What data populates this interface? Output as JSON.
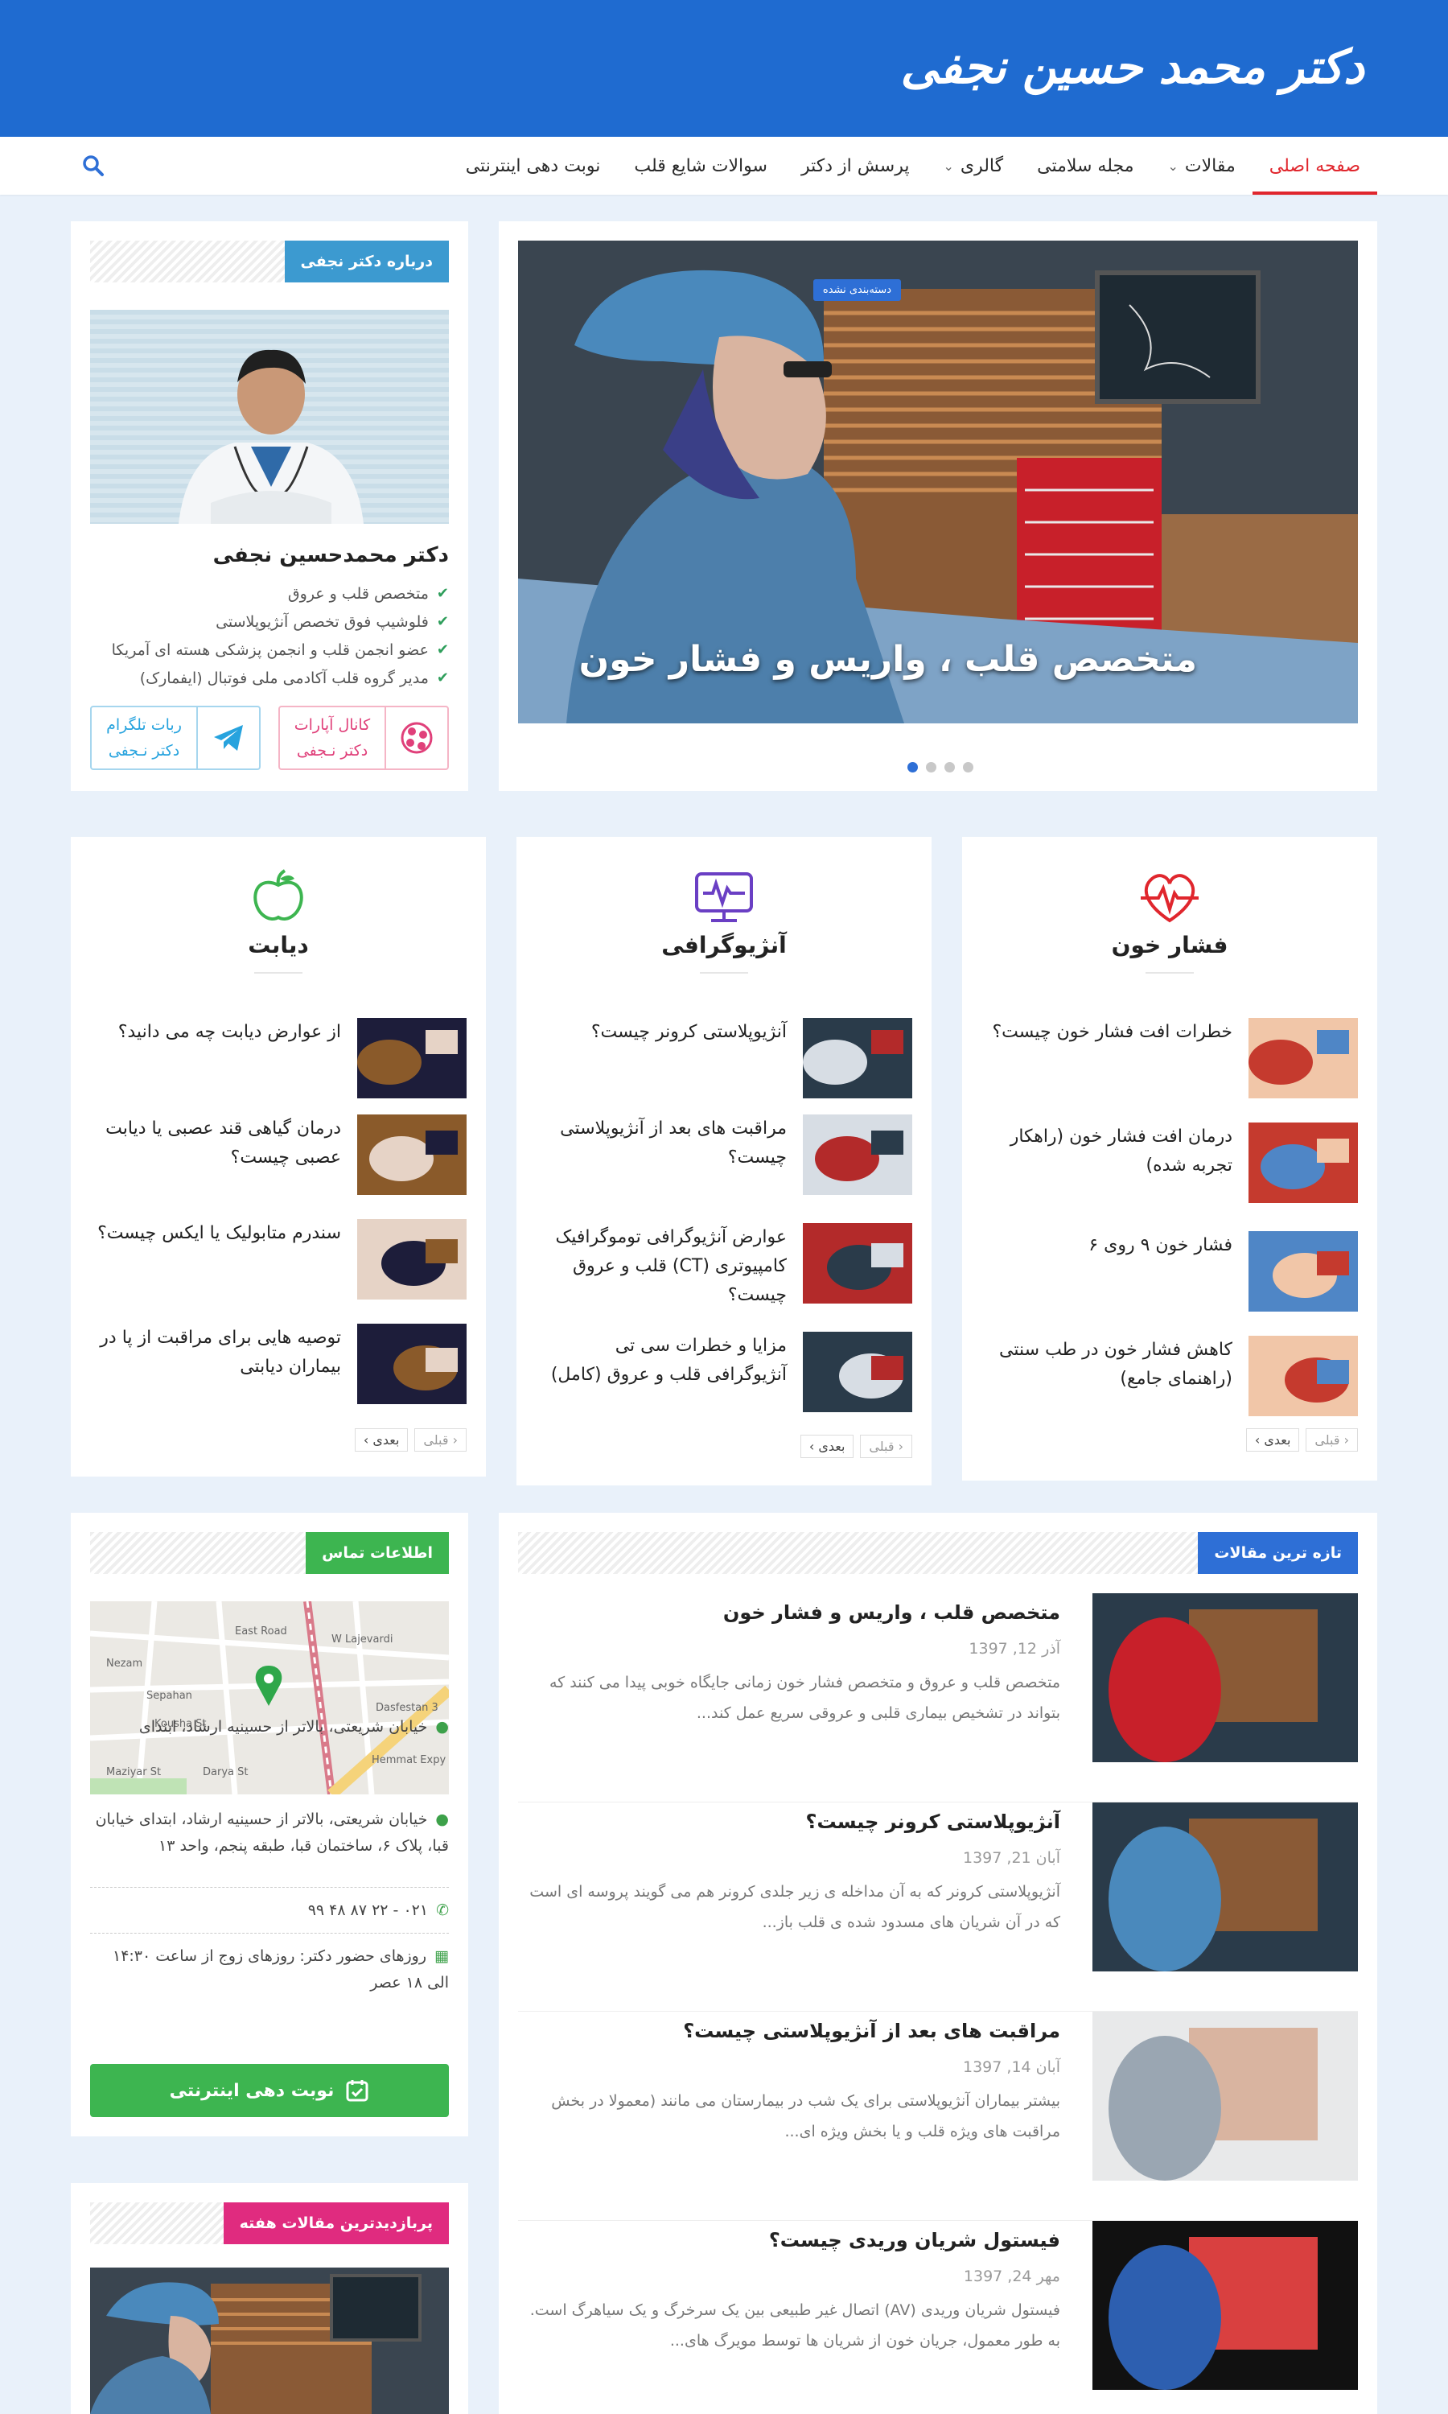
{
  "site": {
    "logo_text": "دکتر محمد حسین نجفی"
  },
  "nav": {
    "items": [
      "صفحه اصلی",
      "مقالات",
      "مجله سلامتی",
      "گالری",
      "پرسش از دکتر",
      "سوالات شایع قلب",
      "نوبت دهی اینترنتی"
    ],
    "has_dropdown": [
      false,
      true,
      false,
      true,
      false,
      false,
      false
    ],
    "active_index": 0
  },
  "slider": {
    "badge": "دسته‌بندی نشده",
    "title": "متخصص قلب ، واریس و فشار خون",
    "slide_count": 4,
    "active_slide": 0
  },
  "about": {
    "heading": "درباره دکتر نجفی",
    "name": "دکتر محمدحسین نجفی",
    "credentials": [
      "متخصص قلب و عروق",
      "فلوشیپ فوق تخصص آنژیوپلاستی",
      "عضو انجمن قلب و انجمن پزشکی هسته ای آمریکا",
      "مدیر گروه قلب آکادمی ملی فوتبال (ایفمارک)"
    ],
    "aparat_line1": "کانال آپارات",
    "aparat_line2": "دکتر نـجفی",
    "telegram_line1": "ربات تلگرام",
    "telegram_line2": "دکتر نـجفی"
  },
  "categories": [
    {
      "title": "فشار خون",
      "icon": "heart-pulse-icon",
      "color": "#e0262d",
      "items": [
        "خطرات افت فشار خون چیست؟",
        "درمان افت فشار خون (راهکار تجربه شده)",
        "فشار خون ۹ روی ۶",
        "کاهش فشار خون در طب سنتی (راهنمای جامع)"
      ]
    },
    {
      "title": "آنژیوگرافی",
      "icon": "monitor-pulse-icon",
      "color": "#6a3fc4",
      "items": [
        "آنژیوپلاستی کرونر چیست؟",
        "مراقبت های بعد از آنژیوپلاستی چیست؟",
        "عوارض آنژیوگرافی توموگرافیک کامپیوتری (CT) قلب و عروق چیست؟",
        "مزایا و خطرات سی تی آنژیوگرافی قلب و عروق (کامل)"
      ]
    },
    {
      "title": "دیابت",
      "icon": "apple-icon",
      "color": "#3db550",
      "items": [
        "از عوارض دیابت چه می دانید؟",
        "درمان گیاهی قند عصبی یا دیابت عصبی چیست؟",
        "سندرم متابولیک یا ایکس چیست؟",
        "توصیه هایی برای مراقبت از پا در بیماران دیابتی"
      ]
    }
  ],
  "pager": {
    "prev": "قبلی",
    "next": "بعدی"
  },
  "latest": {
    "heading": "تازه ترین مقالات",
    "posts": [
      {
        "title": "متخصص قلب ، واریس و فشار خون",
        "date": "آذر 12, 1397",
        "excerpt": "متخصص قلب و عروق و متخصص فشار خون زمانی جایگاه خوبی پیدا می کنند که بتواند در تشخیص بیماری قلبی و عروقی سریع عمل کند..."
      },
      {
        "title": "آنژیوپلاستی کرونر چیست؟",
        "date": "آبان 21, 1397",
        "excerpt": "آنژیوپلاستی کرونر که به آن مداخله ی زیر جلدی کرونر هم می گویند پروسه ای است که در آن شریان های مسدود شده ی قلب باز..."
      },
      {
        "title": "مراقبت های بعد از آنژیوپلاستی چیست؟",
        "date": "آبان 14, 1397",
        "excerpt": "بیشتر بیماران آنژیوپلاستی برای یک شب در بیمارستان می مانند (معمولا در بخش مراقبت های ویژه قلب و یا بخش ویژه ای..."
      },
      {
        "title": "فیستول شریان وریدی چیست؟",
        "date": "مهر 24, 1397",
        "excerpt": "فیستول شریان وریدی (AV) اتصال غیر طبیعی بین یک سرخرگ و یک سیاهرگ است. به طور معمول، جریان خون از شریان ها توسط مویرگ های..."
      }
    ]
  },
  "contact": {
    "heading": "اطلاعات تماس",
    "address_short": "خیابان شریعتی، بالاتر از حسینیه ارشاد، ابتدای",
    "address_full": "خیابان شریعتی، بالاتر از حسینیه ارشاد، ابتدای خیابان قبا، پلاک ۶، ساختمان قبا، طبقه پنجم، واحد ۱۳",
    "phone": "۰۲۱ - ۲۲ ۸۷ ۴۸ ۹۹",
    "hours": "روزهای حضور دکتر: روزهای زوج از ساعت ۱۴:۳۰ الی ۱۸ عصر",
    "booking": "نوبت دهی اینترنتی",
    "map_labels": [
      "Nezam",
      "Sepahan",
      "Kousha St",
      "Maziyar St",
      "Darya St",
      "Hemmat Expy",
      "Dasfestan 3",
      "W Lajevardi",
      "East Road"
    ]
  },
  "popular": {
    "heading": "پربازدیدترین مقالات هفته"
  },
  "colors": {
    "header": "#1f6bd0",
    "accent_red": "#e0262d",
    "green": "#3db550",
    "blue_badge": "#2e6fd6",
    "pink": "#e02b7f"
  }
}
